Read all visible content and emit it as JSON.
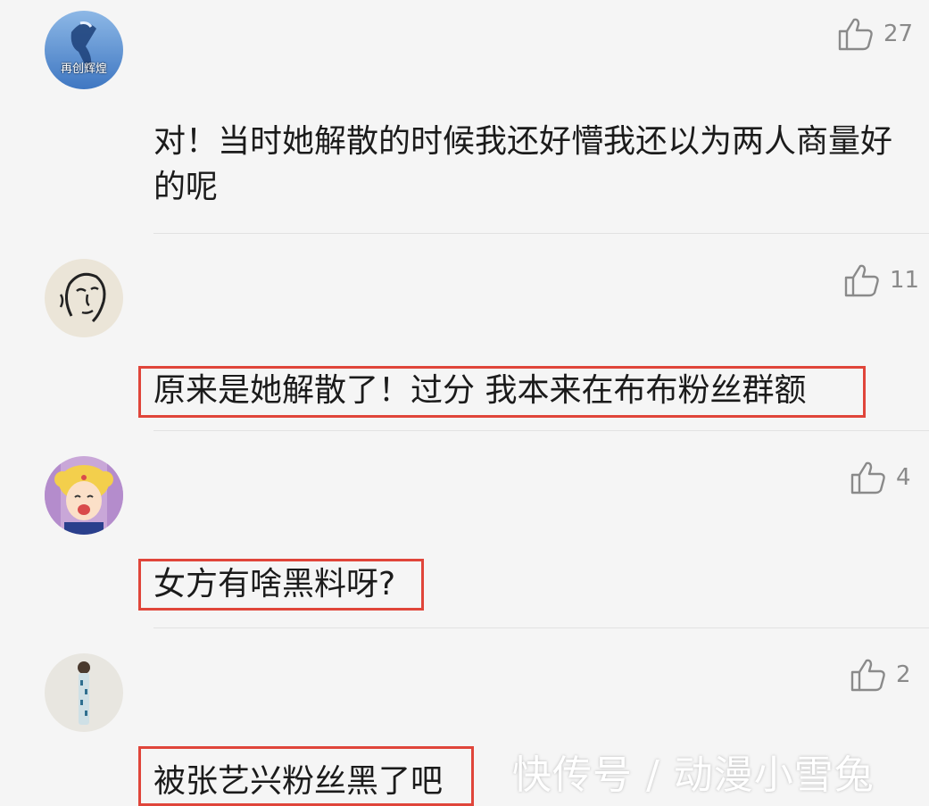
{
  "comments": [
    {
      "avatar_caption": "再创辉煌",
      "likes": "27",
      "text": "对！当时她解散的时候我还好懵我还以为两人商量好的呢",
      "highlighted": false
    },
    {
      "avatar_caption": "",
      "likes": "11",
      "text": "原来是她解散了！过分 我本来在布布粉丝群额",
      "highlighted": true
    },
    {
      "avatar_caption": "",
      "likes": "4",
      "text": "女方有啥黑料呀?",
      "highlighted": true
    },
    {
      "avatar_caption": "",
      "likes": "2",
      "text": "被张艺兴粉丝黑了吧",
      "highlighted": true
    }
  ],
  "watermark": "快传号 / 动漫小雪兔",
  "colors": {
    "background": "#f5f5f5",
    "text": "#1b1b1b",
    "like_count": "#8a8a8a",
    "highlight_border": "#e0453a",
    "divider": "#e2e2e2"
  },
  "icons": {
    "like": "thumbs-up-icon"
  }
}
